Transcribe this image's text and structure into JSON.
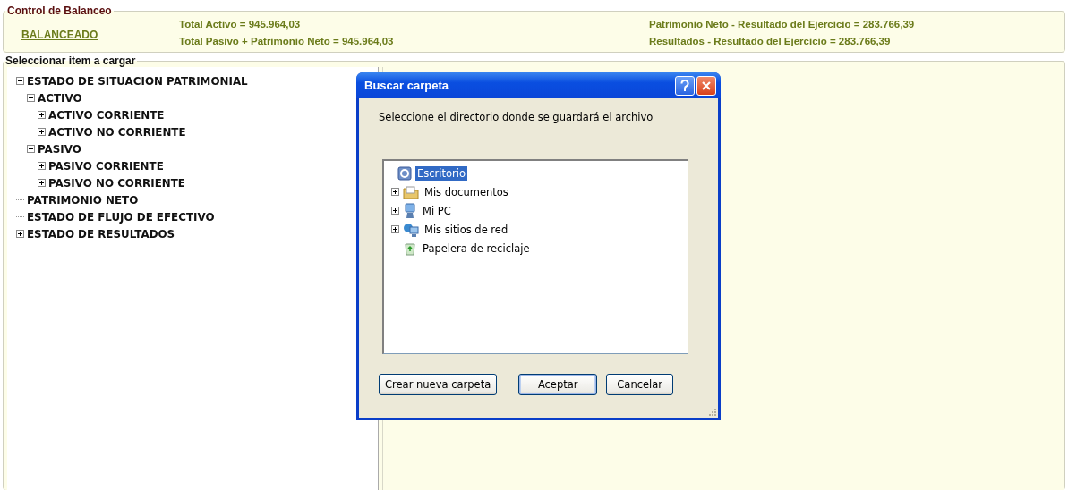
{
  "balance_control": {
    "title": "Control de Balanceo",
    "status": "BALANCEADO",
    "totals": [
      "Total Activo = 945.964,03",
      "Total Pasivo + Patrimonio Neto = 945.964,03"
    ],
    "results": [
      "Patrimonio Neto - Resultado del Ejercicio = 283.766,39",
      "Resultados - Resultado del Ejercicio = 283.766,39"
    ]
  },
  "item_selector": {
    "title": "Seleccionar item a cargar",
    "tree": [
      {
        "label": "ESTADO DE SITUACION PATRIMONIAL",
        "expanded": true,
        "children": [
          {
            "label": "ACTIVO",
            "expanded": true,
            "children": [
              {
                "label": "ACTIVO CORRIENTE",
                "expanded": false
              },
              {
                "label": "ACTIVO NO CORRIENTE",
                "expanded": false
              }
            ]
          },
          {
            "label": "PASIVO",
            "expanded": true,
            "children": [
              {
                "label": "PASIVO  CORRIENTE",
                "expanded": false
              },
              {
                "label": "PASIVO  NO CORRIENTE",
                "expanded": false
              }
            ]
          }
        ]
      },
      {
        "label": "PATRIMONIO NETO"
      },
      {
        "label": "ESTADO DE FLUJO DE EFECTIVO"
      },
      {
        "label": "ESTADO DE RESULTADOS",
        "expanded": false
      }
    ]
  },
  "dialog": {
    "title": "Buscar carpeta",
    "prompt": "Seleccione el directorio donde se guardará el archivo",
    "folders": [
      {
        "label": "Escritorio",
        "kind": "desktop",
        "selected": true,
        "children": [
          {
            "label": "Mis documentos",
            "kind": "documents",
            "expanded": false,
            "selected": false
          },
          {
            "label": "Mi PC",
            "kind": "computer",
            "expanded": false,
            "selected": false
          },
          {
            "label": "Mis sitios de red",
            "kind": "network",
            "expanded": false,
            "selected": false
          },
          {
            "label": "Papelera de reciclaje",
            "kind": "recycle",
            "selected": false
          }
        ]
      }
    ],
    "buttons": [
      {
        "label": "Crear nueva carpeta",
        "default": false
      },
      {
        "label": "Aceptar",
        "default": true
      },
      {
        "label": "Cancelar",
        "default": false
      }
    ]
  }
}
